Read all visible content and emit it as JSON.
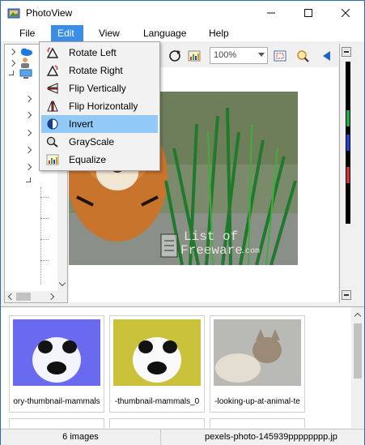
{
  "window": {
    "title": "PhotoView"
  },
  "menu": {
    "file": "File",
    "edit": "Edit",
    "view": "View",
    "language": "Language",
    "help": "Help"
  },
  "toolbar": {
    "zoom_value": "100%"
  },
  "edit_menu": {
    "items": [
      {
        "label": "Rotate Left",
        "icon": "rotate-left-icon"
      },
      {
        "label": "Rotate Right",
        "icon": "rotate-right-icon"
      },
      {
        "label": "Flip Vertically",
        "icon": "flip-vertical-icon"
      },
      {
        "label": "Flip Horizontally",
        "icon": "flip-horizontal-icon"
      },
      {
        "label": "Invert",
        "icon": "invert-icon",
        "highlighted": true
      },
      {
        "label": "GrayScale",
        "icon": "grayscale-icon"
      },
      {
        "label": "Equalize",
        "icon": "equalize-icon"
      }
    ]
  },
  "watermark": {
    "line1": "List of",
    "line2": "Freeware",
    "suffix": ".com"
  },
  "thumbnails": [
    {
      "caption": "ory-thumbnail-mammals"
    },
    {
      "caption": "-thumbnail-mammals_0"
    },
    {
      "caption": "-looking-up-at-animal-te"
    }
  ],
  "status": {
    "count": "6 images",
    "filename": "pexels-photo-145939pppppppp.jp"
  },
  "colors": {
    "menu_active": "#3b8ee8",
    "menu_highlight": "#91c9f7",
    "window_border": "#2b6cb0"
  }
}
